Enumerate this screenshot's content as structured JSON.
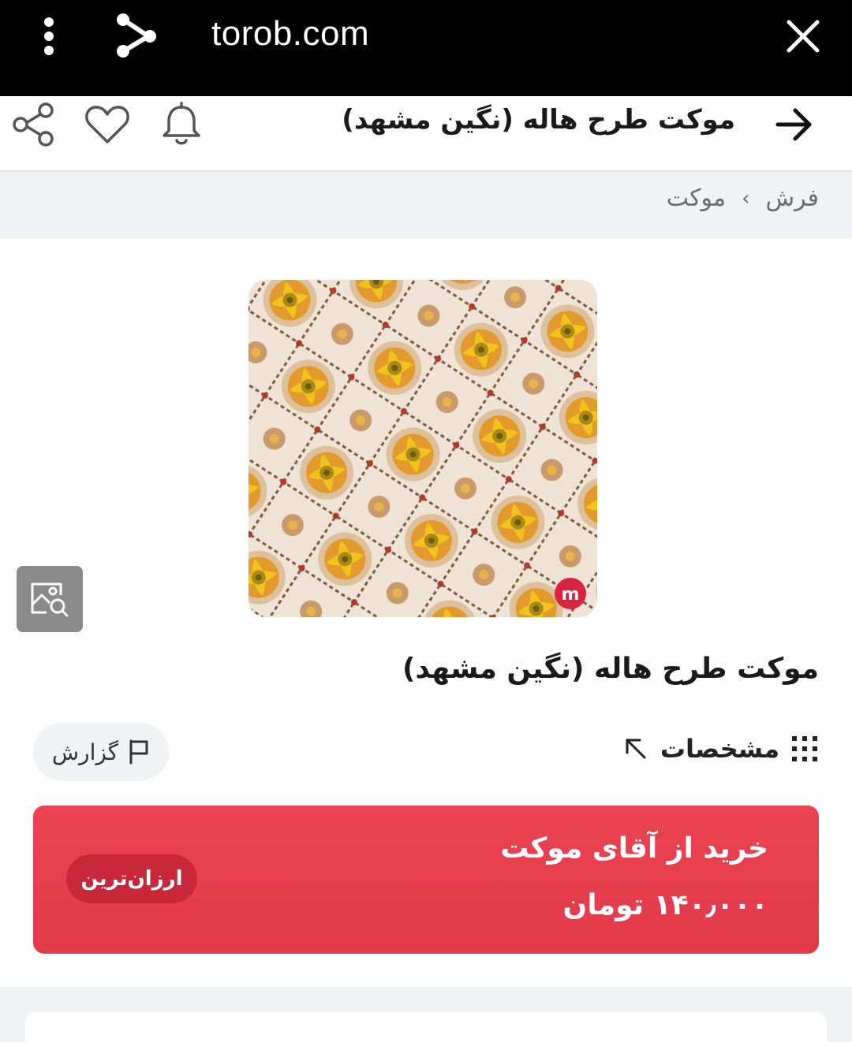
{
  "browser": {
    "url": "torob.com",
    "icons": [
      "more-vertical-icon",
      "share-nodes-icon",
      "close-icon"
    ]
  },
  "header": {
    "title": "موکت طرح هاله (نگین مشهد)",
    "icons": [
      "back-arrow-icon",
      "bell-icon",
      "heart-icon",
      "share-icon"
    ]
  },
  "breadcrumb": {
    "items": [
      "فرش",
      "موکت"
    ],
    "separator": "›"
  },
  "product": {
    "title": "موکت طرح هاله (نگین مشهد)",
    "image_alt": "carpet-pattern-image",
    "specs_label": "مشخصات",
    "report_label": "گزارش"
  },
  "offer": {
    "store_label": "خرید از آقای موکت",
    "price_label": "۱۴۰٫۰۰۰ تومان",
    "badge": "ارزان‌ترین"
  },
  "colors": {
    "browser_bar": "#000000",
    "buy_button": "#e63e4e",
    "badge": "#c8283a",
    "page_bg": "#f1f2f4"
  }
}
